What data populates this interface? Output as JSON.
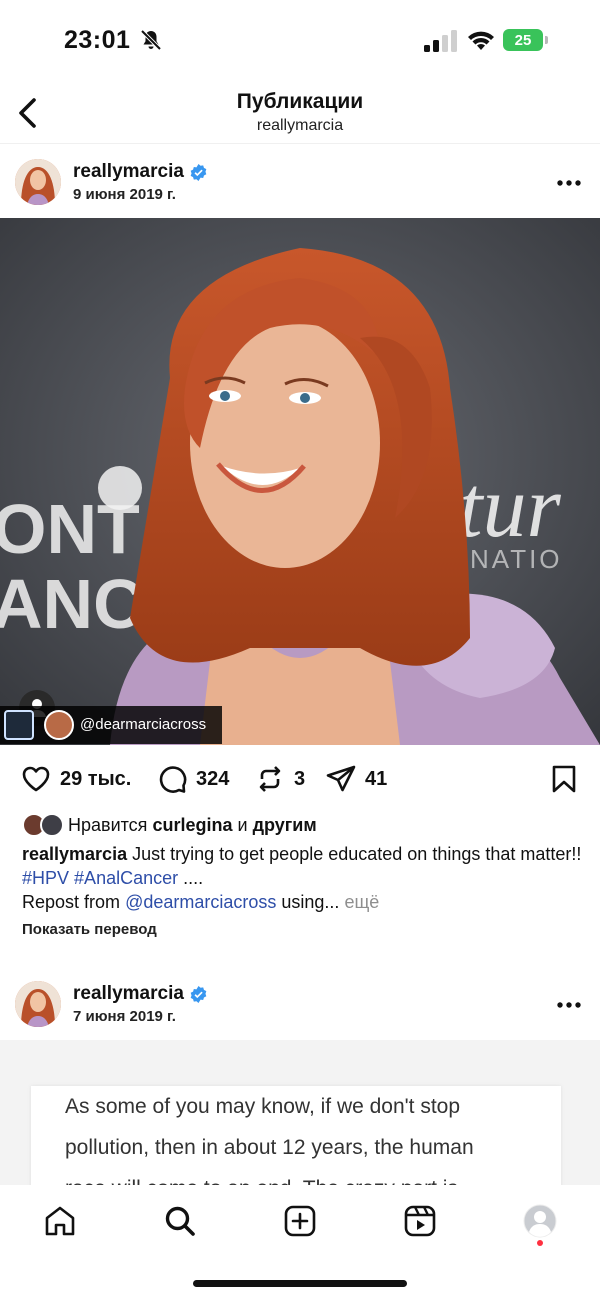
{
  "status_bar": {
    "time": "23:01",
    "battery": "25"
  },
  "header": {
    "title": "Публикации",
    "subtitle": "reallymarcia"
  },
  "post1": {
    "username": "reallymarcia",
    "date": "9 июня 2019 г.",
    "photo_tag": "@dearmarciacross",
    "likes": "29 тыс.",
    "comments": "324",
    "reposts": "3",
    "shares": "41",
    "liked_by_prefix": "Нравится",
    "liked_by_user": "curlegina",
    "liked_by_and": "и",
    "liked_by_others": "другим",
    "caption_user": "reallymarcia",
    "caption_text": "Just trying to get people educated on things that matter!!",
    "hashtag1": "#HPV",
    "hashtag2": "#AnalCancer",
    "caption_ellipsis": "....",
    "repost_from": "Repost from",
    "repost_user": "@dearmarciacross",
    "repost_using": "using...",
    "more_label": "ещё",
    "translate_label": "Показать перевод",
    "photo_sign_left_1": "ONT",
    "photo_sign_left_2": "ANC",
    "photo_sign_right_1": "tur",
    "photo_sign_right_2": "NATIO"
  },
  "post2": {
    "username": "reallymarcia",
    "date": "7 июня 2019 г.",
    "text_line1": "As some of you may know, if we don't stop",
    "text_line2": "pollution, then in about 12 years, the human",
    "text_line3": "race will come to an end. The crazy part is"
  },
  "tabbar": {
    "items": [
      "home-icon",
      "search-icon",
      "create-icon",
      "reels-icon",
      "profile-avatar"
    ]
  },
  "colors": {
    "verified": "#3897f0",
    "link": "#2e4ea8",
    "battery": "#39c35a",
    "notification": "#ff3040"
  }
}
